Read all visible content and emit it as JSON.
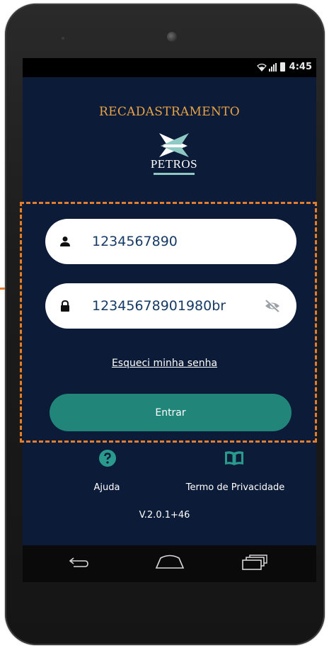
{
  "status_bar": {
    "time": "4:45"
  },
  "app": {
    "title": "RECADASTRAMENTO",
    "logo_text": "PETROS"
  },
  "login": {
    "user_value": "1234567890",
    "password_value": "12345678901980br",
    "forgot_label": "Esqueci minha senha",
    "enter_label": "Entrar"
  },
  "footer": {
    "help_label": "Ajuda",
    "privacy_label": "Termo de Privacidade",
    "version": "V.2.0.1+46"
  },
  "colors": {
    "background": "#0c1b37",
    "accent": "#218579",
    "title": "#e7a347",
    "highlight": "#e07d2e",
    "icon_teal": "#2a9a8c"
  },
  "icons": {
    "user": "person-icon",
    "password": "lock-icon",
    "toggle_visibility": "eye-off-icon",
    "help": "help-circle-icon",
    "privacy": "book-icon"
  }
}
